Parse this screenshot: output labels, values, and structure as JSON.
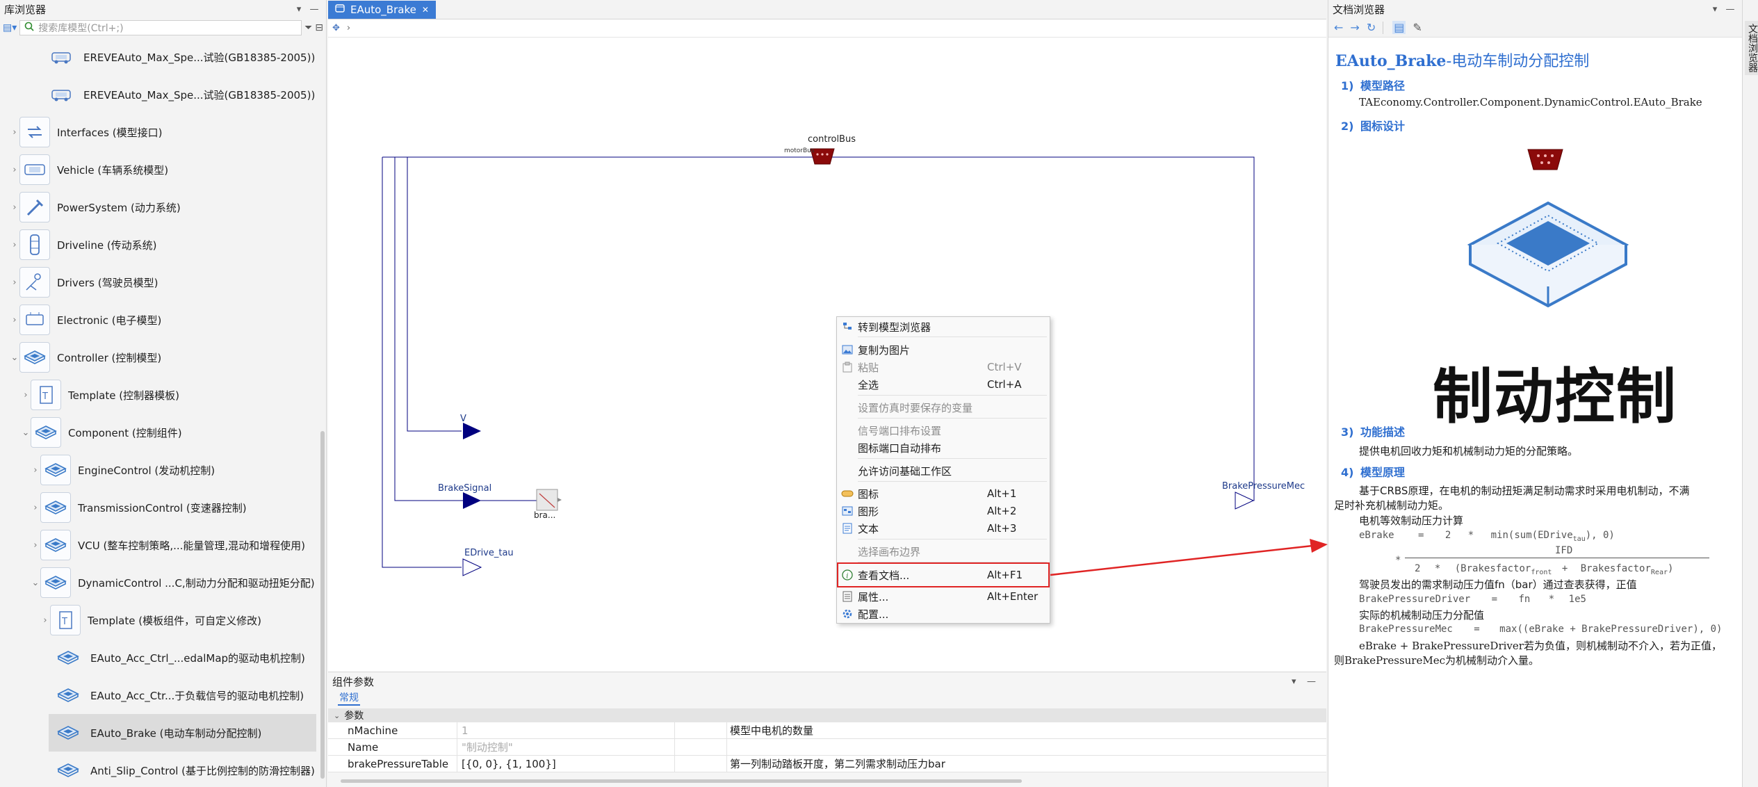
{
  "library_browser": {
    "title": "库浏览器",
    "search_placeholder": "搜索库模型(Ctrl+;)",
    "items": [
      {
        "label": "EREVEAuto_Max_Spe...试验(GB18385-2005))",
        "icon": "car-icon"
      },
      {
        "label": "EREVEAuto_Max_Spe...试验(GB18385-2005))",
        "icon": "car-icon"
      },
      {
        "label": "Interfaces (模型接口)",
        "icon": "interface-icon"
      },
      {
        "label": "Vehicle (车辆系统模型)",
        "icon": "vehicle-icon"
      },
      {
        "label": "PowerSystem (动力系统)",
        "icon": "power-icon"
      },
      {
        "label": "Driveline (传动系统)",
        "icon": "driveline-icon"
      },
      {
        "label": "Drivers (驾驶员模型)",
        "icon": "driver-icon"
      },
      {
        "label": "Electronic (电子模型)",
        "icon": "electronic-icon"
      },
      {
        "label": "Controller (控制模型)",
        "icon": "chip-icon"
      },
      {
        "label": "Template (控制器模板)",
        "icon": "template-icon"
      },
      {
        "label": "Component (控制组件)",
        "icon": "chip-icon"
      },
      {
        "label": "EngineControl (发动机控制)",
        "icon": "chip-icon"
      },
      {
        "label": "TransmissionControl (变速器控制)",
        "icon": "chip-icon"
      },
      {
        "label": "VCU (整车控制策略,...能量管理,混动和增程使用)",
        "icon": "chip-icon"
      },
      {
        "label": "DynamicControl ...C,制动力分配和驱动扭矩分配)",
        "icon": "chip-icon"
      },
      {
        "label": "Template (模板组件，可自定义修改)",
        "icon": "template-icon"
      },
      {
        "label": "EAuto_Acc_Ctrl_...edalMap的驱动电机控制)",
        "icon": "chip-icon"
      },
      {
        "label": "EAuto_Acc_Ctr...于负载信号的驱动电机控制)",
        "icon": "chip-icon"
      },
      {
        "label": "EAuto_Brake (电动车制动分配控制)",
        "icon": "chip-icon"
      },
      {
        "label": "Anti_Slip_Control (基于比例控制的防滑控制器)",
        "icon": "chip-icon"
      }
    ]
  },
  "editor": {
    "tab_label": "EAuto_Brake",
    "diagram_labels": {
      "control_bus": "controlBus",
      "motor_bus": "motorBus",
      "v": "V",
      "brake_signal": "BrakeSignal",
      "bra": "bra...",
      "edrive_tau": "EDrive_tau",
      "brake_pressure_mec": "BrakePressureMec"
    }
  },
  "context_menu": {
    "items": [
      {
        "label": "转到模型浏览器",
        "shortcut": "",
        "disabled": false,
        "icon": "tree-icon"
      },
      {
        "label": "复制为图片",
        "shortcut": "",
        "disabled": false,
        "icon": "image-icon"
      },
      {
        "label": "粘贴",
        "shortcut": "Ctrl+V",
        "disabled": true,
        "icon": "paste-icon"
      },
      {
        "label": "全选",
        "shortcut": "Ctrl+A",
        "disabled": false,
        "icon": ""
      },
      {
        "label": "设置仿真时要保存的变量",
        "shortcut": "",
        "disabled": true,
        "icon": ""
      },
      {
        "label": "信号端口排布设置",
        "shortcut": "",
        "disabled": true,
        "icon": ""
      },
      {
        "label": "图标端口自动排布",
        "shortcut": "",
        "disabled": false,
        "icon": ""
      },
      {
        "label": "允许访问基础工作区",
        "shortcut": "",
        "disabled": false,
        "icon": ""
      },
      {
        "label": "图标",
        "shortcut": "Alt+1",
        "disabled": false,
        "icon": "icon-view-icon"
      },
      {
        "label": "图形",
        "shortcut": "Alt+2",
        "disabled": false,
        "icon": "diagram-view-icon"
      },
      {
        "label": "文本",
        "shortcut": "Alt+3",
        "disabled": false,
        "icon": "text-view-icon"
      },
      {
        "label": "选择画布边界",
        "shortcut": "",
        "disabled": true,
        "icon": ""
      },
      {
        "label": "查看文档...",
        "shortcut": "Alt+F1",
        "disabled": false,
        "icon": "info-icon"
      },
      {
        "label": "属性...",
        "shortcut": "Alt+Enter",
        "disabled": false,
        "icon": "properties-icon"
      },
      {
        "label": "配置...",
        "shortcut": "",
        "disabled": false,
        "icon": "config-icon"
      }
    ]
  },
  "params": {
    "title": "组件参数",
    "tab": "常规",
    "group": "参数",
    "rows": [
      {
        "name": "nMachine",
        "value": "1",
        "desc": "模型中电机的数量",
        "placeholder": true
      },
      {
        "name": "Name",
        "value": "\"制动控制\"",
        "desc": "",
        "placeholder": true
      },
      {
        "name": "brakePressureTable",
        "value": "[{0, 0}, {1, 100}]",
        "desc": "第一列制动踏板开度，第二列需求制动压力bar",
        "placeholder": false
      }
    ]
  },
  "doc_browser": {
    "title": "文档浏览器",
    "heading_name": "EAuto_Brake",
    "heading_desc": "-电动车制动分配控制",
    "sec1_title": "模型路径",
    "sec1_text": "TAEconomy.Controller.Component.DynamicControl.EAuto_Brake",
    "sec2_title": "图标设计",
    "big_text": "制动控制",
    "sec3_title": "功能描述",
    "sec3_text": "提供电机回收力矩和机械制动力矩的分配策略。",
    "sec4_title": "模型原理",
    "p1_l1": "基于CRBS原理，在电机的制动扭矩满足制动需求时采用电机制动，不满",
    "p1_l2": "足时补充机械制动力矩。",
    "p2": "电机等效制动压力计算",
    "f1_left": "eBrake",
    "f1_eq": "=",
    "f1_two": "2",
    "f1_star": "*",
    "f1_min": "min(sum(EDrive",
    "f1_sub": "tau",
    "f1_tail": "),  0)",
    "f1_num": "IFD",
    "f1_den_a": "2",
    "f1_den_star": "*",
    "f1_den_b": "(Brakesfactor",
    "f1_den_sub1": "front",
    "f1_den_plus": "+",
    "f1_den_c": "Brakesfactor",
    "f1_den_sub2": "Rear",
    "f1_den_close": ")",
    "p3": "驾驶员发出的需求制动压力值fn（bar）通过查表获得，正值",
    "f2_left": "BrakePressureDriver",
    "f2_eq": "=",
    "f2_fn": "fn",
    "f2_star": "*",
    "f2_val": "1e5",
    "p4": "实际的机械制动压力分配值",
    "f3_left": "BrakePressureMec",
    "f3_eq": "=",
    "f3_rhs": "max((eBrake   +  BrakePressureDriver),  0)",
    "p5_l1": "eBrake + BrakePressureDriver若为负值，则机械制动不介入，若为正值，",
    "p5_l2": "则BrakePressureMec为机械制动介入量。"
  },
  "side_strip": {
    "label": "文档浏览器"
  },
  "colors": {
    "accent": "#2f6fd0",
    "tab_active": "#3b7bd4",
    "highlight_red": "#e02424",
    "connector_navy": "#00007f",
    "bus_red": "#8b0000"
  }
}
